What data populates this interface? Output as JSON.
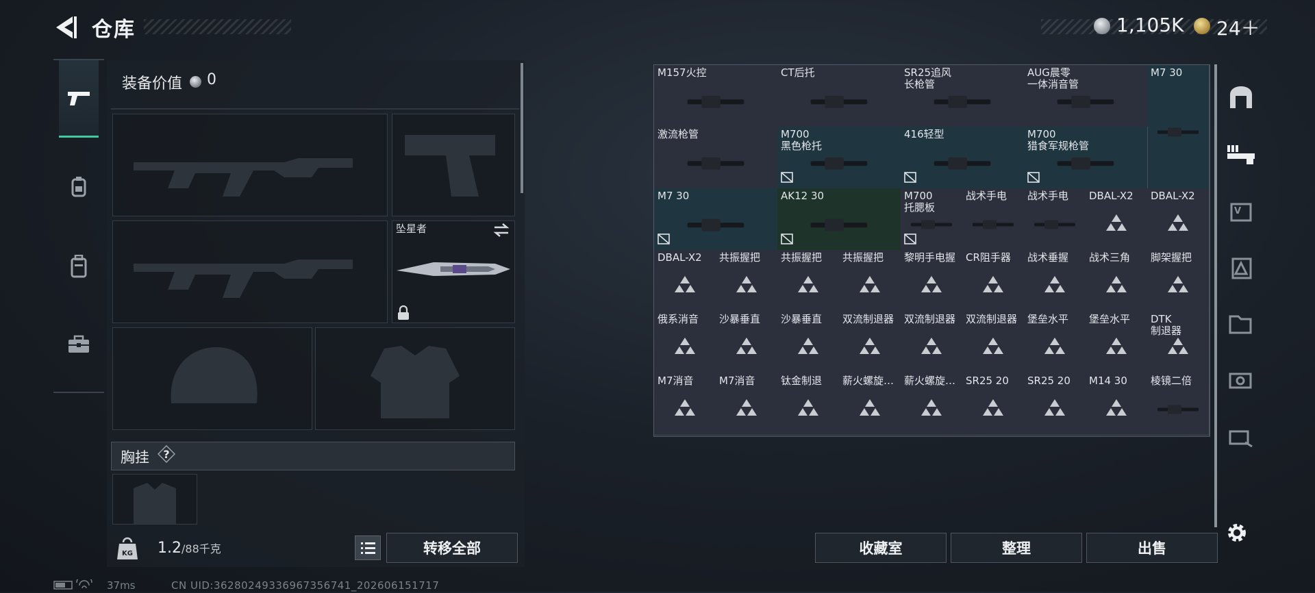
{
  "header": {
    "title": "仓库"
  },
  "currency": {
    "silver": "1,105K",
    "gold": "24＋"
  },
  "equipment": {
    "value_label": "装备价值",
    "value": "0",
    "knife_name": "坠星者",
    "chest_label": "胸挂",
    "help_mark": "?"
  },
  "weight": {
    "current": "1.2",
    "capacity": "/88千克"
  },
  "buttons": {
    "transfer_all": "转移全部",
    "collection": "收藏室",
    "sort": "整理",
    "sell": "出售"
  },
  "grid_items": [
    {
      "name": "M157火控",
      "tint": "gray"
    },
    {
      "name": "CT后托",
      "tint": "gray"
    },
    {
      "name": "SR25追风\n长枪管",
      "tint": "gray"
    },
    {
      "name": "AUG晨零\n一体消音管",
      "tint": "gray"
    },
    {
      "name": "M7 30",
      "tint": "teal"
    },
    {
      "name": "激流枪管",
      "tint": "gray"
    },
    {
      "name": "M700\n黑色枪托",
      "tint": "teal"
    },
    {
      "name": "416轻型",
      "tint": "teal"
    },
    {
      "name": "M700\n猎食军规枪管",
      "tint": "teal"
    },
    {
      "name": "M7 30",
      "tint": "teal"
    },
    {
      "name": "AK12 30",
      "tint": "green"
    },
    {
      "name": "M700\n托腮板",
      "tint": "gray"
    },
    {
      "name": "战术手电",
      "tint": "gray"
    },
    {
      "name": "战术手电",
      "tint": "gray"
    },
    {
      "name": "DBAL-X2",
      "tint": "gray"
    },
    {
      "name": "DBAL-X2",
      "tint": "gray"
    },
    {
      "name": "DBAL-X2",
      "tint": "gray"
    },
    {
      "name": "共振握把",
      "tint": "gray"
    },
    {
      "name": "共振握把",
      "tint": "gray"
    },
    {
      "name": "共振握把",
      "tint": "gray"
    },
    {
      "name": "黎明手电握",
      "tint": "gray"
    },
    {
      "name": "CR阻手器",
      "tint": "gray"
    },
    {
      "name": "战术垂握",
      "tint": "gray"
    },
    {
      "name": "战术三角",
      "tint": "gray"
    },
    {
      "name": "脚架握把",
      "tint": "gray"
    },
    {
      "name": "俄系消音",
      "tint": "gray"
    },
    {
      "name": "沙暴垂直",
      "tint": "gray"
    },
    {
      "name": "沙暴垂直",
      "tint": "gray"
    },
    {
      "name": "双流制退器",
      "tint": "gray"
    },
    {
      "name": "双流制退器",
      "tint": "gray"
    },
    {
      "name": "双流制退器",
      "tint": "gray"
    },
    {
      "name": "堡垒水平",
      "tint": "gray"
    },
    {
      "name": "堡垒水平",
      "tint": "gray"
    },
    {
      "name": "DTK\n制退器",
      "tint": "gray"
    },
    {
      "name": "M7消音",
      "tint": "gray"
    },
    {
      "name": "M7消音",
      "tint": "gray"
    },
    {
      "name": "钛金制退",
      "tint": "gray"
    },
    {
      "name": "薪火螺旋…",
      "tint": "gray"
    },
    {
      "name": "薪火螺旋…",
      "tint": "gray"
    },
    {
      "name": "SR25 20",
      "tint": "gray"
    },
    {
      "name": "SR25 20",
      "tint": "gray"
    },
    {
      "name": "M14 30",
      "tint": "gray"
    },
    {
      "name": "棱镜二倍",
      "tint": "gray"
    }
  ],
  "status": {
    "ping": "37ms",
    "uid": "CN UID:36280249336967356741_202606151717"
  }
}
